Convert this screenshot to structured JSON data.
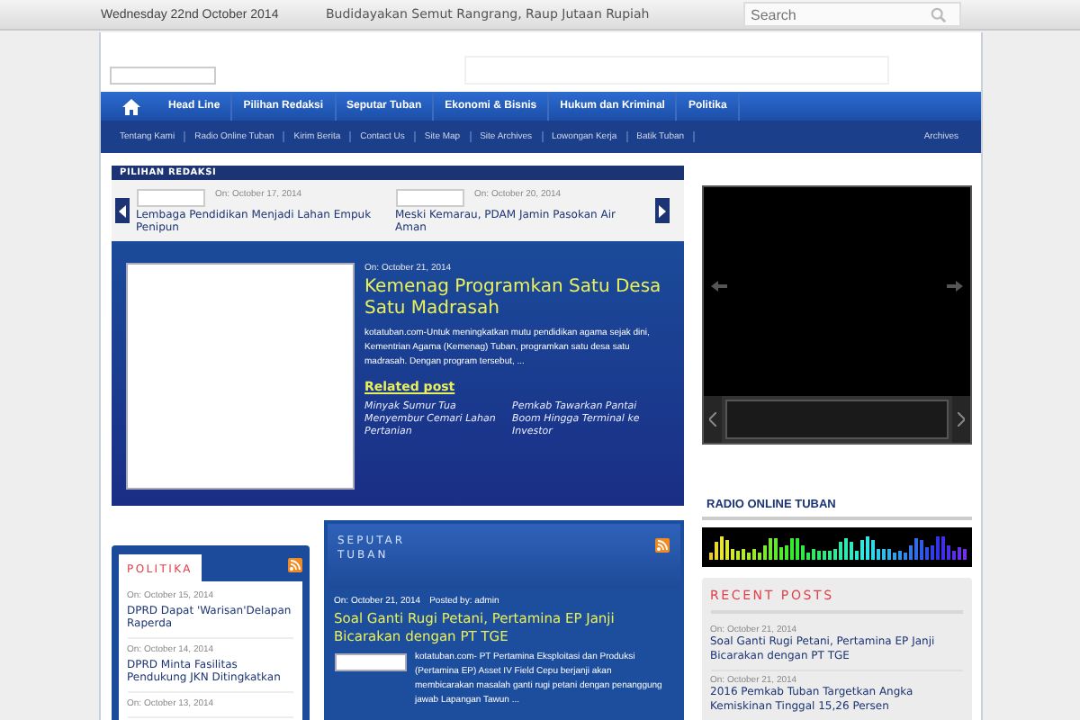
{
  "top_bar": {
    "date": "Wednesday 22nd October 2014",
    "ticker": "Budidayakan Semut Rangrang, Raup Jutaan Rupiah",
    "search": {
      "placeholder": "Search"
    }
  },
  "nav_main": {
    "items": [
      "Head Line",
      "Pilihan Redaksi",
      "Seputar Tuban",
      "Ekonomi & Bisnis",
      "Hukum dan Kriminal",
      "Politika"
    ]
  },
  "nav_sub": {
    "items": [
      "Tentang Kami",
      "Radio Online Tuban",
      "Kirim Berita",
      "Contact Us",
      "Site Map",
      "Site Archives",
      "Lowongan Kerja",
      "Batik Tuban"
    ],
    "archives": "Archives"
  },
  "pilihan_redaksi": {
    "title": "PILIHAN REDAKSI",
    "slides": [
      {
        "date": "On: October 17, 2014",
        "title": "Lembaga Pendidikan Menjadi Lahan Empuk Penipun"
      },
      {
        "date": "On: October 20, 2014",
        "title": "Meski Kemarau, PDAM Jamin Pasokan Air Aman"
      }
    ],
    "featured": {
      "date": "On: October 21, 2014",
      "title": "Kemenag Programkan Satu Desa Satu Madrasah",
      "excerpt": "kotatuban.com-Untuk meningkatkan mutu pendidikan agama sejak dini, Kementrian Agama (Kemenag) Tuban, programkan satu desa satu madrasah. Dengan program tersebut, ...",
      "related_title": "Related post",
      "related": [
        "Minyak Sumur Tua Menyembur Cemari Lahan Pertanian",
        "Pemkab Tawarkan Pantai Boom Hingga Terminal ke Investor"
      ]
    }
  },
  "politika": {
    "title": "POLITIKA",
    "posts": [
      {
        "date": "On: October 15, 2014",
        "title": "DPRD Dapat 'Warisan'Delapan Raperda"
      },
      {
        "date": "On: October 14, 2014",
        "title": "DPRD Minta Fasilitas Pendukung JKN Ditingkatkan"
      },
      {
        "date": "On: October 13, 2014"
      }
    ]
  },
  "seputar_tuban": {
    "title": "SEPUTAR TUBAN",
    "post": {
      "date": "On: October 21, 2014",
      "author": "Posted by: admin",
      "title": "Soal Ganti Rugi Petani, Pertamina EP Janji Bicarakan dengan PT TGE",
      "excerpt": "kotatuban.com- PT Pertamina Eksploitasi dan Produksi (Pertamina EP) Asset IV Field Cepu berjanji akan membicarakan masalah ganti rugi petani dengan penanggung jawab Lapangan Tawun ..."
    }
  },
  "radio": {
    "title": "RADIO ONLINE TUBAN"
  },
  "recent_posts": {
    "title": "RECENT POSTS",
    "posts": [
      {
        "date": "On: October 21, 2014",
        "title": "Soal Ganti Rugi Petani, Pertamina EP Janji Bicarakan dengan PT TGE"
      },
      {
        "date": "On: October 21, 2014",
        "title": "2016 Pemkab Tuban Targetkan Angka Kemiskinan Tinggal 15,26 Persen"
      }
    ]
  }
}
